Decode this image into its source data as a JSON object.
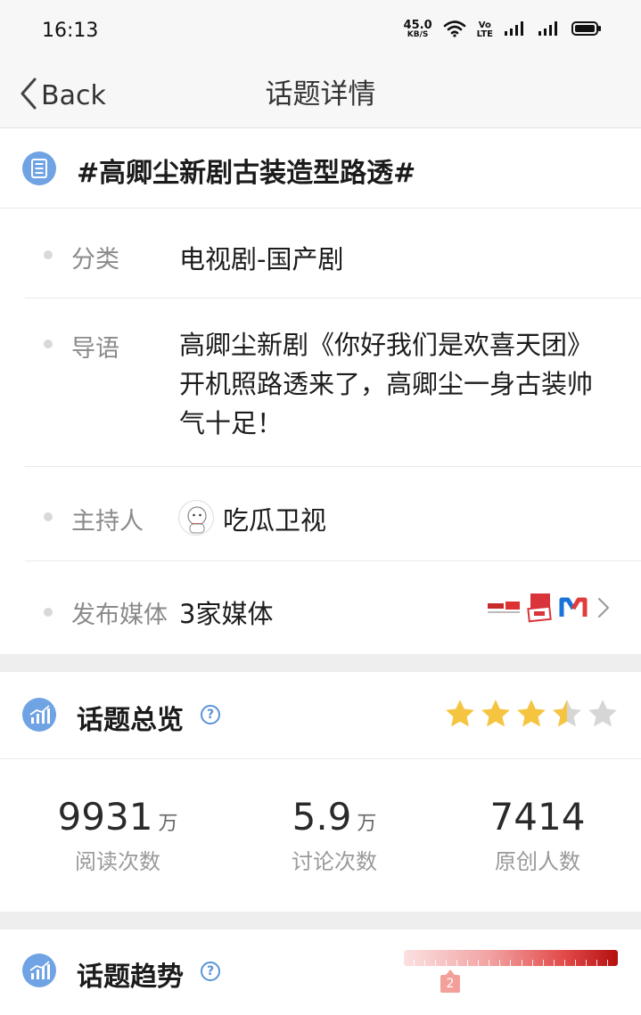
{
  "status_bar": {
    "time": "16:13",
    "net_speed": "45.0",
    "net_unit": "KB/S",
    "volte_top": "Vo",
    "volte_bottom": "LTE"
  },
  "nav": {
    "back_label": "Back",
    "title": "话题详情"
  },
  "topic": {
    "name": "#高卿尘新剧古装造型路透#",
    "icon": "list-document-icon"
  },
  "details": {
    "category_key": "分类",
    "category_value": "电视剧-国产剧",
    "guide_key": "导语",
    "guide_value": "高卿尘新剧《你好我们是欢喜天团》开机照路透来了，高卿尘一身古装帅气十足！",
    "host_key": "主持人",
    "host_value": "吃瓜卫视",
    "media_key": "发布媒体",
    "media_value": "3家媒体"
  },
  "overview": {
    "title": "话题总览",
    "rating": 3.5,
    "rating_max": 5,
    "stats": [
      {
        "value": "9931",
        "unit": "万",
        "label": "阅读次数"
      },
      {
        "value": "5.9",
        "unit": "万",
        "label": "讨论次数"
      },
      {
        "value": "7414",
        "unit": "",
        "label": "原创人数"
      }
    ]
  },
  "trend": {
    "title": "话题趋势",
    "level": "2"
  },
  "colors": {
    "accent_blue": "#5b93d8",
    "star_gold": "#f5c542",
    "star_grey": "#d6d6d6",
    "trend_red": "#b40f0f"
  }
}
